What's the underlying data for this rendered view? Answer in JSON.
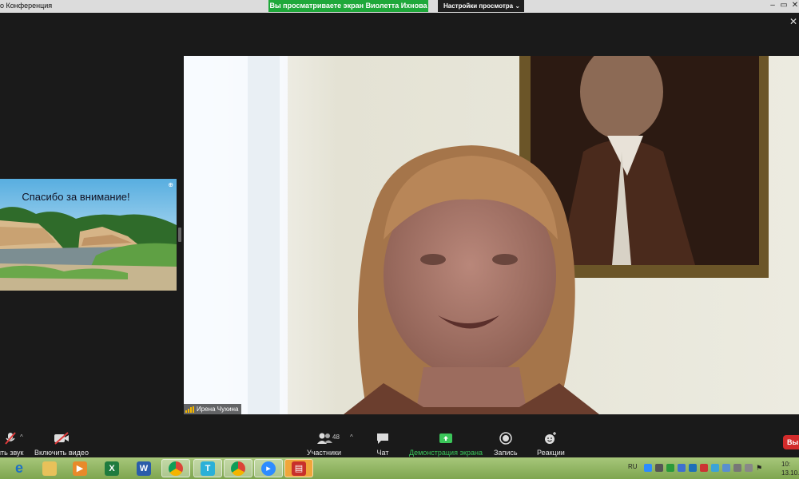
{
  "window": {
    "title": "o Конференция",
    "share_banner": "Вы просматриваете экран Виолетта Ихнова",
    "view_settings": "Настройки просмотра ⌄"
  },
  "slide": {
    "title": "Спасибо за внимание!"
  },
  "video": {
    "participant_name": "Ирена Чухина"
  },
  "toolbar": {
    "audio_label": "ить звук",
    "video_label": "Включить видео",
    "participants_label": "Участники",
    "participants_count": "48",
    "chat_label": "Чат",
    "share_label": "Демонстрация экрана",
    "record_label": "Запись",
    "reactions_label": "Реакции",
    "end_label": "Вы"
  },
  "taskbar": {
    "language": "RU",
    "time": "10:",
    "date": "13.10."
  },
  "colors": {
    "share_green": "#1fa83a",
    "end_red": "#d22b2b",
    "taskbar": "#8fb35e"
  }
}
